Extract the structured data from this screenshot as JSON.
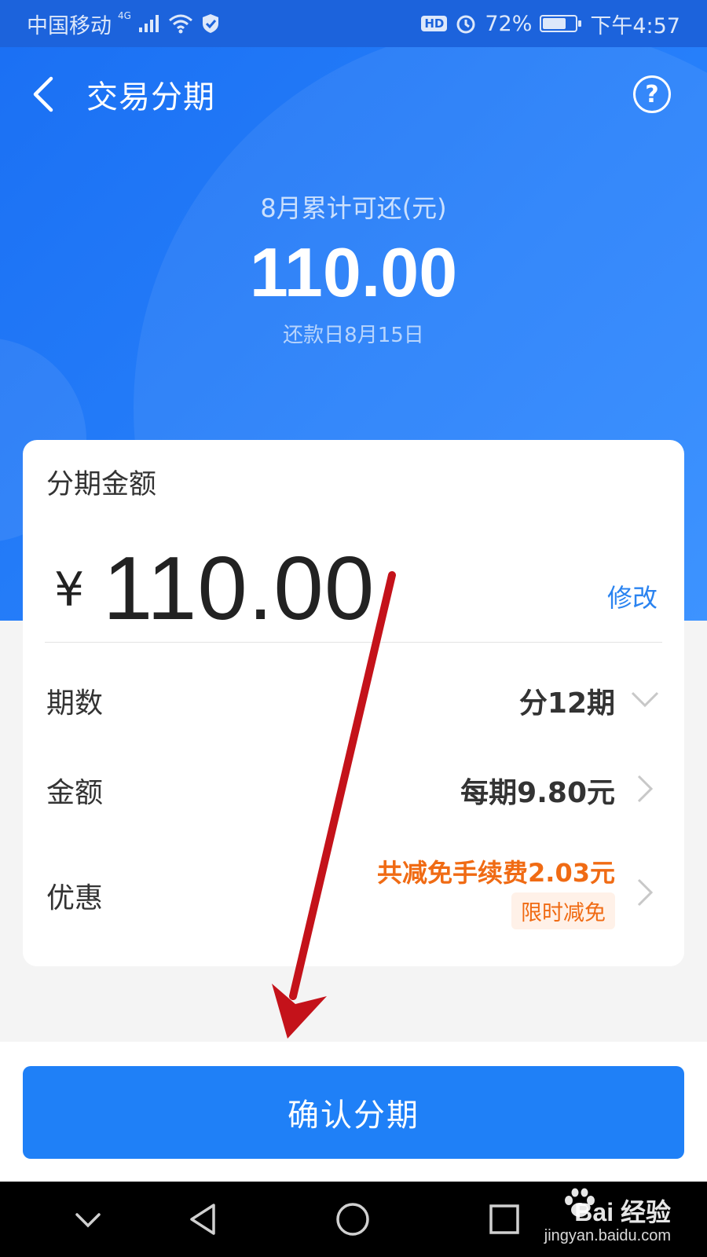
{
  "status_bar": {
    "carrier": "中国移动",
    "network": "4G",
    "hd_label": "HD",
    "battery_percent": "72%",
    "battery_level": 0.72,
    "time": "下午4:57"
  },
  "header": {
    "title": "交易分期",
    "back_icon": "chevron-left-icon",
    "help_icon": "question-circle-icon",
    "help_text": "?"
  },
  "summary": {
    "label": "8月累计可还(元)",
    "amount": "110.00",
    "due_date": "还款日8月15日"
  },
  "card": {
    "title": "分期金额",
    "currency": "¥",
    "amount": "110.00",
    "edit_label": "修改",
    "rows": [
      {
        "label": "期数",
        "value": "分12期",
        "chevron": "chevron-down-icon"
      },
      {
        "label": "金额",
        "value": "每期9.80元",
        "chevron": "chevron-right-icon"
      },
      {
        "label": "优惠",
        "value": "共减免手续费2.03元",
        "badge": "限时减免",
        "chevron": "chevron-right-icon"
      }
    ]
  },
  "confirm_button": {
    "label": "确认分期"
  },
  "nav_bar": {
    "items": [
      "chevron-down-icon",
      "back-triangle-icon",
      "home-circle-icon",
      "recents-square-icon"
    ]
  },
  "watermark": {
    "brand": "Bai  经验",
    "url": "jingyan.baidu.com"
  },
  "colors": {
    "primary_blue": "#1f80f7",
    "promo_orange": "#f06b14",
    "annotation_red": "#c4121a"
  }
}
